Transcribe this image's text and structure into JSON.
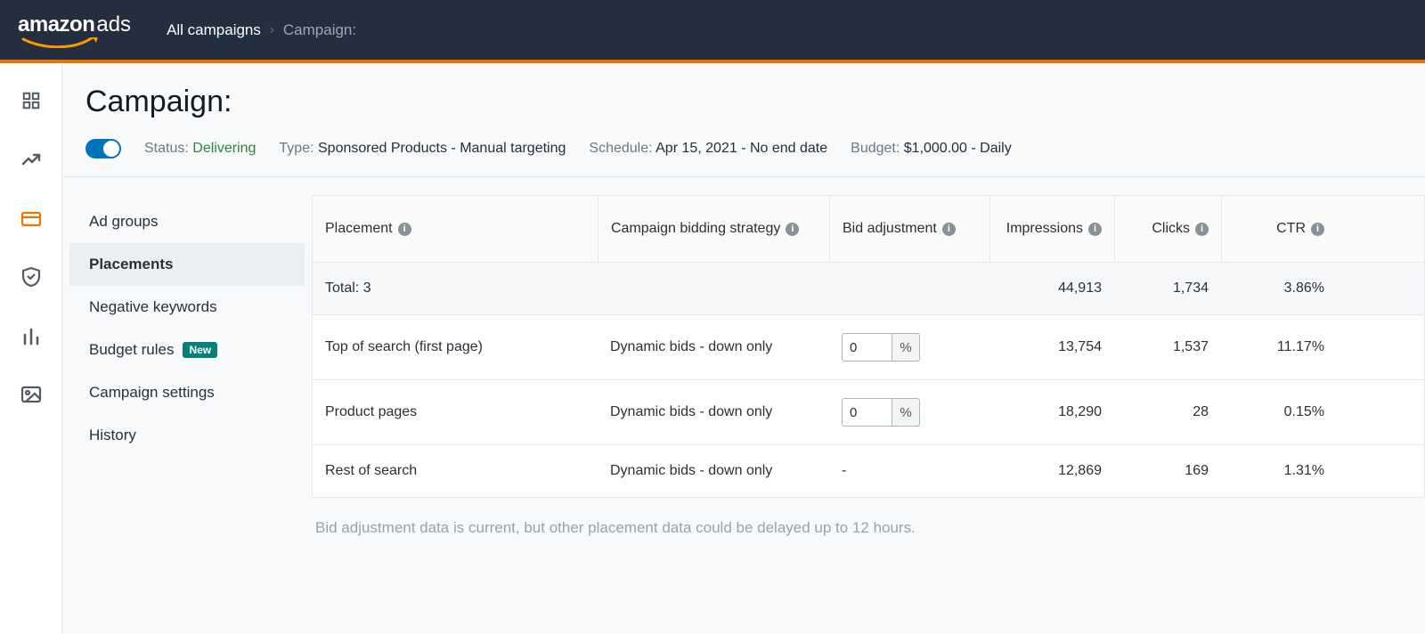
{
  "topbar": {
    "logo_left": "amazon",
    "logo_right": "ads",
    "breadcrumb_root": "All campaigns",
    "breadcrumb_current": "Campaign:"
  },
  "header": {
    "title": "Campaign:",
    "status_label": "Status:",
    "status_value": "Delivering",
    "type_label": "Type:",
    "type_value": "Sponsored Products - Manual targeting",
    "schedule_label": "Schedule:",
    "schedule_value": "Apr 15, 2021 - No end date",
    "budget_label": "Budget:",
    "budget_value": "$1,000.00 - Daily"
  },
  "leftnav": {
    "items": [
      {
        "label": "Ad groups"
      },
      {
        "label": "Placements"
      },
      {
        "label": "Negative keywords"
      },
      {
        "label": "Budget rules",
        "badge": "New"
      },
      {
        "label": "Campaign settings"
      },
      {
        "label": "History"
      }
    ],
    "active_index": 1
  },
  "table": {
    "columns": {
      "placement": "Placement",
      "strategy": "Campaign bidding strategy",
      "bid_adj": "Bid adjustment",
      "impressions": "Impressions",
      "clicks": "Clicks",
      "ctr": "CTR"
    },
    "total": {
      "label": "Total: 3",
      "impressions": "44,913",
      "clicks": "1,734",
      "ctr": "3.86%"
    },
    "rows": [
      {
        "placement": "Top of search (first page)",
        "strategy": "Dynamic bids - down only",
        "bid_value": "0",
        "bid_unit": "%",
        "impressions": "13,754",
        "clicks": "1,537",
        "ctr": "11.17%"
      },
      {
        "placement": "Product pages",
        "strategy": "Dynamic bids - down only",
        "bid_value": "0",
        "bid_unit": "%",
        "impressions": "18,290",
        "clicks": "28",
        "ctr": "0.15%"
      },
      {
        "placement": "Rest of search",
        "strategy": "Dynamic bids - down only",
        "bid_value": "-",
        "bid_unit": "",
        "impressions": "12,869",
        "clicks": "169",
        "ctr": "1.31%"
      }
    ],
    "footnote": "Bid adjustment data is current, but other placement data could be delayed up to 12 hours."
  },
  "chart_data": {
    "type": "table",
    "title": "Placements performance",
    "columns": [
      "Placement",
      "Impressions",
      "Clicks",
      "CTR"
    ],
    "rows": [
      [
        "Top of search (first page)",
        13754,
        1537,
        11.17
      ],
      [
        "Product pages",
        18290,
        28,
        0.15
      ],
      [
        "Rest of search",
        12869,
        169,
        1.31
      ]
    ],
    "totals": {
      "Impressions": 44913,
      "Clicks": 1734,
      "CTR": 3.86
    }
  }
}
